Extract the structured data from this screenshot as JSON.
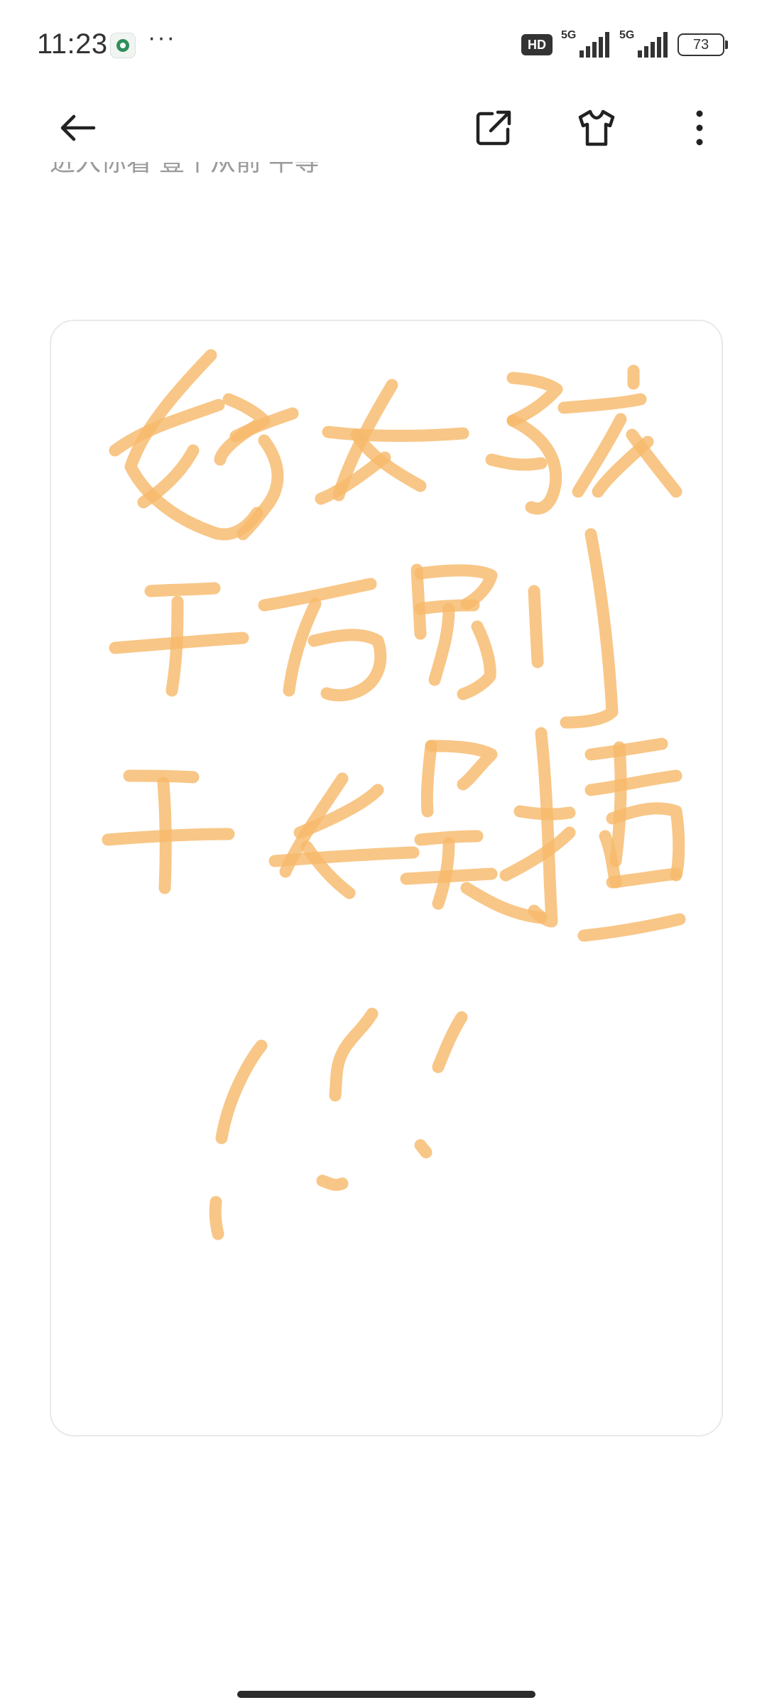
{
  "status_bar": {
    "time": "11:23",
    "more_indicator": "···",
    "hd_label": "HD",
    "network_1": "5G",
    "network_2": "5G",
    "battery_level": "73"
  },
  "toolbar": {
    "back_icon": "arrow-left-icon",
    "share_icon": "external-share-icon",
    "shirt_icon": "t-shirt-icon",
    "more_icon": "more-vertical-icon"
  },
  "post": {
    "cut_off_caption": "进入你看 壹个从前 平等",
    "handwriting_lines": [
      "好女孩",
      "千万别",
      "干娱播",
      "!!!"
    ],
    "ink_color": "#f7b96b"
  }
}
